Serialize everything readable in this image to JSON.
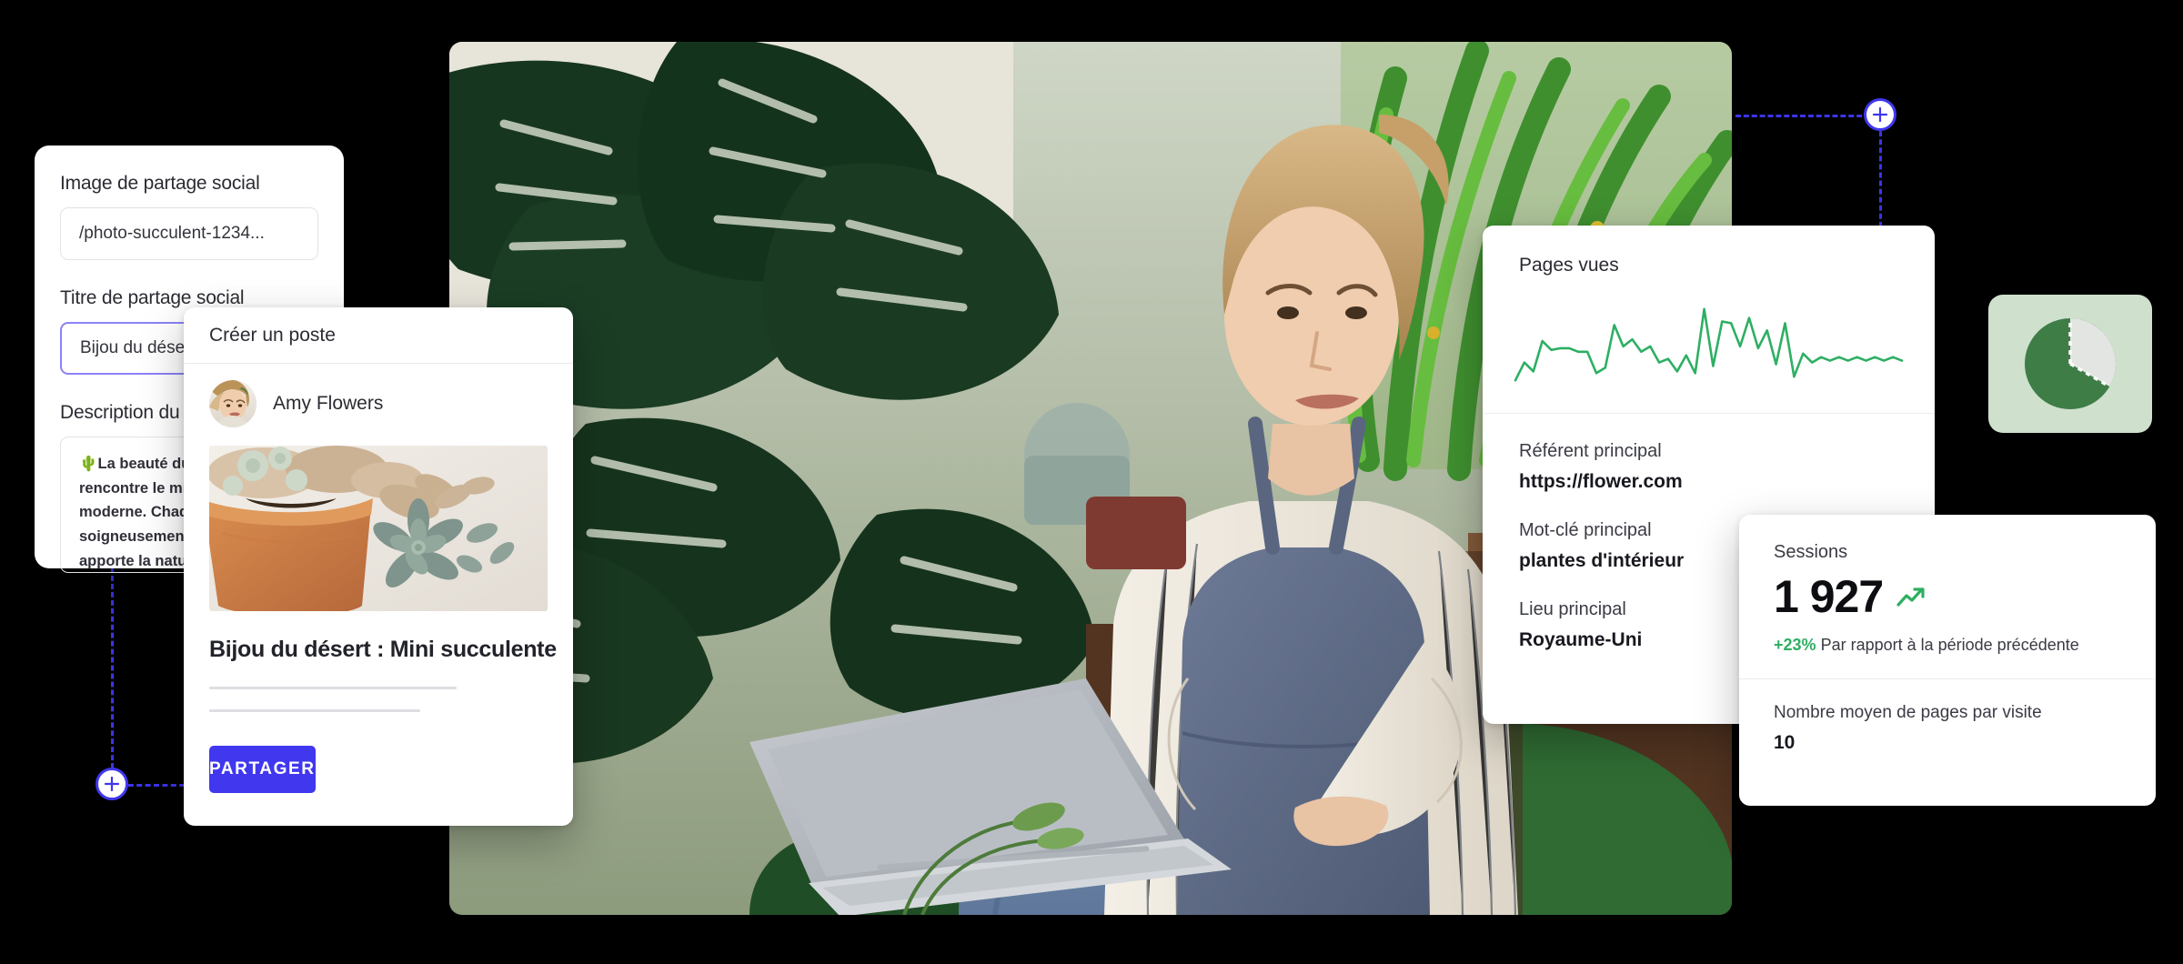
{
  "social_panel": {
    "image_label": "Image de partage social",
    "image_value": "/photo-succulent-1234...",
    "title_label": "Titre de partage social",
    "title_value": "Bijou du désert",
    "description_label": "Description du",
    "description_value": "🌵La beauté du désert rencontre le minimalisme moderne. Chaque pièce soigneusement sélectionnée apporte la nature la plus résistante à votre rebord de fenêtre. ✨ #L'amour #Familledeplantes"
  },
  "post_card": {
    "header": "Créer un poste",
    "author": "Amy Flowers",
    "post_title": "Bijou du désert : Mini succulente",
    "share_label": "PARTAGER"
  },
  "analytics": {
    "title": "Pages vues",
    "metrics": [
      {
        "label": "Référent principal",
        "value": "https://flower.com"
      },
      {
        "label": "Mot-clé principal",
        "value": "plantes d'intérieur"
      },
      {
        "label": "Lieu principal",
        "value": "Royaume-Uni"
      }
    ]
  },
  "sessions": {
    "label": "Sessions",
    "value": "1 927",
    "delta": "+23%",
    "delta_text": "Par rapport à la période précédente",
    "avg_label": "Nombre moyen de pages par visite",
    "avg_value": "10"
  },
  "colors": {
    "brand_purple": "#4037ef",
    "accent_green": "#2eaf63",
    "pie_green": "#3f7d47",
    "pie_grey": "#e2e5e2",
    "pie_bg": "#cfe0cd",
    "page_bg": "#000000"
  },
  "icons": {
    "node_top_right": "plus-icon",
    "node_bottom_left": "plus-icon",
    "trend": "trend-up-icon",
    "pie": "pie-chart-icon"
  },
  "chart_data": {
    "type": "line",
    "title": "Pages vues",
    "xlabel": "",
    "ylabel": "",
    "grid": false,
    "legend": "none",
    "ylim": [
      0,
      100
    ],
    "x": [
      0,
      1,
      2,
      3,
      4,
      5,
      6,
      7,
      8,
      9,
      10,
      11,
      12,
      13,
      14,
      15,
      16,
      17,
      18,
      19,
      20,
      21,
      22,
      23,
      24,
      25,
      26,
      27,
      28,
      29,
      30,
      31,
      32,
      33,
      34,
      35,
      36,
      37,
      38,
      39,
      40,
      41,
      42,
      43
    ],
    "series": [
      {
        "name": "Pages vues",
        "color": "#2eaf63",
        "values": [
          8,
          28,
          18,
          52,
          42,
          44,
          44,
          40,
          40,
          16,
          22,
          70,
          46,
          54,
          40,
          46,
          28,
          32,
          18,
          36,
          16,
          88,
          24,
          74,
          72,
          46,
          78,
          44,
          64,
          26,
          72,
          12,
          38,
          28,
          34,
          30,
          34,
          30,
          34,
          30,
          34,
          30,
          34,
          30
        ]
      }
    ]
  }
}
